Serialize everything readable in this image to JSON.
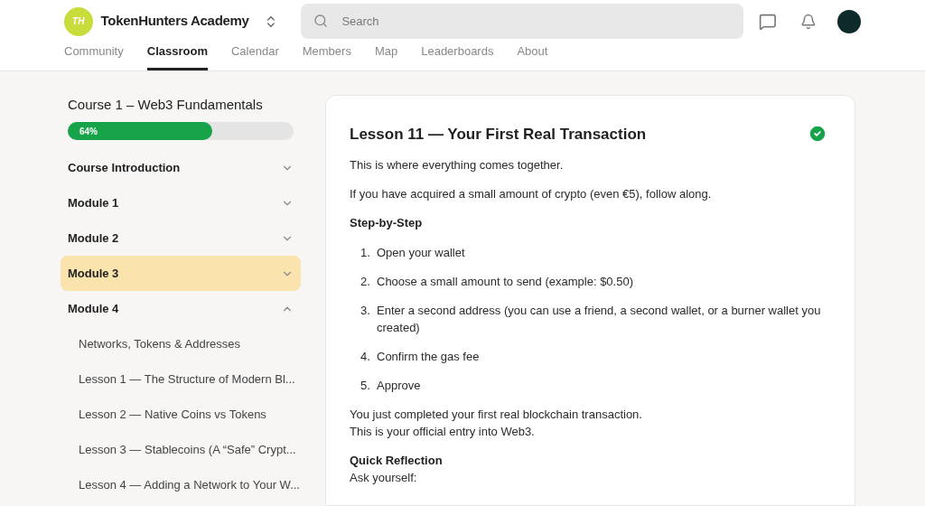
{
  "header": {
    "logo_mark": "TH",
    "brand": "TokenHunters Academy",
    "search": {
      "placeholder": "Search"
    }
  },
  "nav": [
    {
      "label": "Community",
      "selected": false
    },
    {
      "label": "Classroom",
      "selected": true
    },
    {
      "label": "Calendar",
      "selected": false
    },
    {
      "label": "Members",
      "selected": false
    },
    {
      "label": "Map",
      "selected": false
    },
    {
      "label": "Leaderboards",
      "selected": false
    },
    {
      "label": "About",
      "selected": false
    }
  ],
  "sidebar": {
    "course_title": "Course 1 – Web3 Fundamentals",
    "progress": {
      "level": 0.64,
      "reading": "64%"
    },
    "modules": [
      {
        "label": "Course Introduction",
        "expanded": false,
        "selected": false
      },
      {
        "label": "Module 1",
        "expanded": false,
        "selected": false
      },
      {
        "label": "Module 2",
        "expanded": false,
        "selected": false
      },
      {
        "label": "Module 3",
        "expanded": false,
        "selected": true
      },
      {
        "label": "Module 4",
        "expanded": true,
        "selected": false,
        "children": [
          {
            "label": "Networks, Tokens & Addresses"
          },
          {
            "label": "Lesson 1 — The Structure of Modern Bl..."
          },
          {
            "label": "Lesson 2 — Native Coins vs Tokens"
          },
          {
            "label": "Lesson 3 — Stablecoins (A “Safe” Crypt..."
          },
          {
            "label": "Lesson 4 — Adding a Network to Your W..."
          }
        ]
      }
    ]
  },
  "lesson": {
    "title": "Lesson 11 — Your First Real Transaction",
    "completed": true,
    "blocks": [
      {
        "kind": "paragraph",
        "lines": [
          "This is where everything comes together."
        ]
      },
      {
        "kind": "paragraph",
        "lines": [
          "If you have acquired a small amount of crypto (even €5), follow along."
        ]
      },
      {
        "kind": "heading",
        "text": "Step-by-Step"
      },
      {
        "kind": "list",
        "items": [
          {
            "number": "1.",
            "text": "Open your wallet"
          },
          {
            "number": "2.",
            "text": "Choose a small amount to send (example: $0.50)"
          },
          {
            "number": "3.",
            "text": "Enter a second address (you can use a friend, a second wallet, or a burner wallet you created)"
          },
          {
            "number": "4.",
            "text": "Confirm the gas fee"
          },
          {
            "number": "5.",
            "text": "Approve"
          }
        ]
      },
      {
        "kind": "paragraph",
        "lines": [
          "You just completed your first real blockchain transaction.",
          "This is your official entry into Web3."
        ]
      },
      {
        "kind": "subheading",
        "text": "Quick Reflection"
      },
      {
        "kind": "tight",
        "lines": [
          "Ask yourself:"
        ]
      }
    ]
  }
}
